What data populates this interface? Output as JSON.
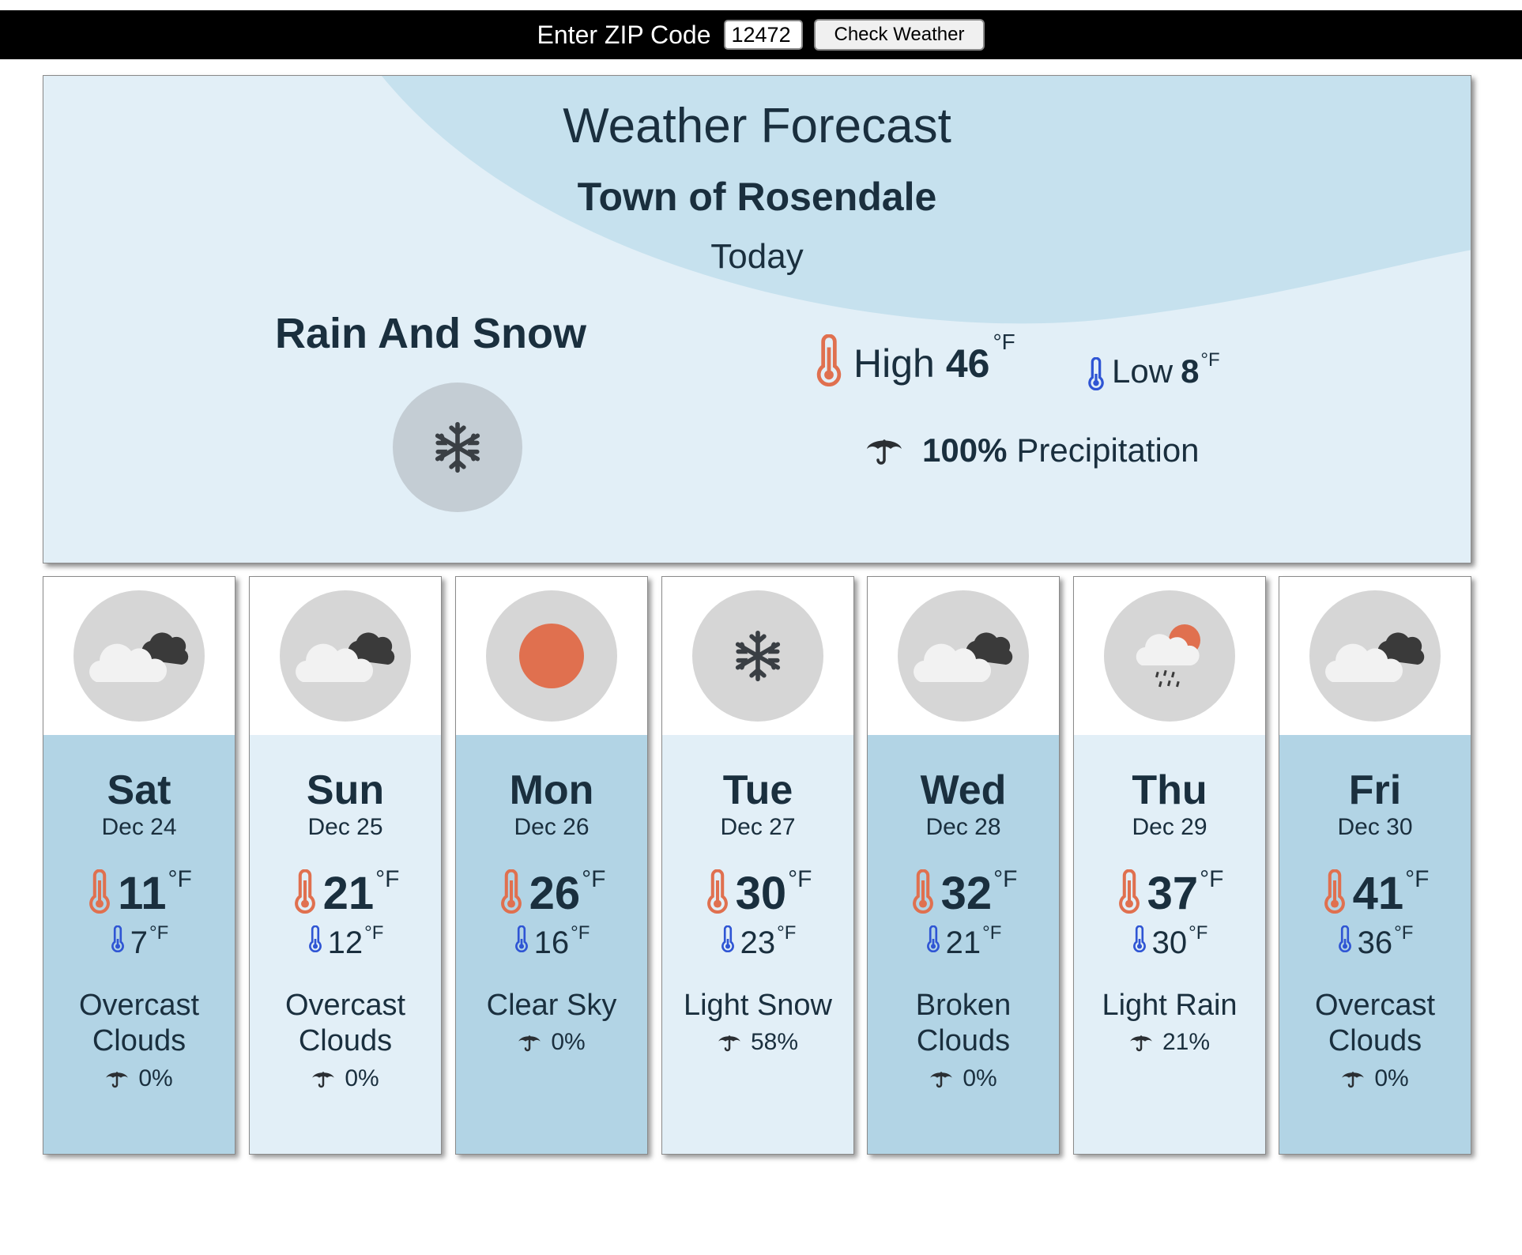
{
  "topbar": {
    "zip_label": "Enter ZIP Code",
    "zip_value": "12472",
    "button_label": "Check Weather"
  },
  "today": {
    "title": "Weather Forecast",
    "town": "Town of Rosendale",
    "day_label": "Today",
    "condition": "Rain And Snow",
    "icon": "snowflake-icon",
    "high_label": "High",
    "high": "46",
    "low_label": "Low",
    "low": "8",
    "unit": "°F",
    "precip_pct": "100%",
    "precip_label": "Precipitation"
  },
  "colors": {
    "panel_light": "#e2eff7",
    "panel_dark": "#b2d4e5",
    "arc": "#c6e1ee",
    "thermo_high": "#e0704f",
    "thermo_low": "#2f55d4",
    "text": "#1a2f3e"
  },
  "forecast": [
    {
      "day": "Sat",
      "date": "Dec 24",
      "high": "11",
      "low": "7",
      "unit": "°F",
      "desc": "Overcast Clouds",
      "precip": "0%",
      "icon": "overcast-clouds-icon"
    },
    {
      "day": "Sun",
      "date": "Dec 25",
      "high": "21",
      "low": "12",
      "unit": "°F",
      "desc": "Overcast Clouds",
      "precip": "0%",
      "icon": "overcast-clouds-icon"
    },
    {
      "day": "Mon",
      "date": "Dec 26",
      "high": "26",
      "low": "16",
      "unit": "°F",
      "desc": "Clear Sky",
      "precip": "0%",
      "icon": "sun-icon"
    },
    {
      "day": "Tue",
      "date": "Dec 27",
      "high": "30",
      "low": "23",
      "unit": "°F",
      "desc": "Light Snow",
      "precip": "58%",
      "icon": "snowflake-icon"
    },
    {
      "day": "Wed",
      "date": "Dec 28",
      "high": "32",
      "low": "21",
      "unit": "°F",
      "desc": "Broken Clouds",
      "precip": "0%",
      "icon": "broken-clouds-icon"
    },
    {
      "day": "Thu",
      "date": "Dec 29",
      "high": "37",
      "low": "30",
      "unit": "°F",
      "desc": "Light Rain",
      "precip": "21%",
      "icon": "light-rain-icon"
    },
    {
      "day": "Fri",
      "date": "Dec 30",
      "high": "41",
      "low": "36",
      "unit": "°F",
      "desc": "Overcast Clouds",
      "precip": "0%",
      "icon": "overcast-clouds-icon"
    }
  ]
}
